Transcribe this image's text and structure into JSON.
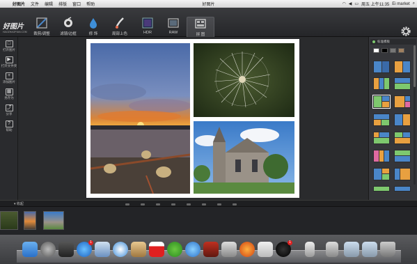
{
  "menubar": {
    "app_name": "好图片",
    "items": [
      "文件",
      "编辑",
      "排版",
      "窗口",
      "帮助"
    ],
    "window_title": "好图片",
    "clock": "周五 上午11:35",
    "user": "Ei market"
  },
  "toolbar": {
    "logo_text": "好图片",
    "logo_sub": "HAOZHAOPIAN.COM",
    "tools": [
      {
        "label": "裁剪/调整",
        "icon": "crop-pen-icon"
      },
      {
        "label": "滤镜/边框",
        "icon": "filter-icon"
      },
      {
        "label": "修 饰",
        "icon": "drop-icon"
      },
      {
        "label": "局部上色",
        "icon": "brush-icon"
      },
      {
        "label": "HDR",
        "icon": "hdr-icon"
      },
      {
        "label": "RAW",
        "icon": "raw-icon"
      },
      {
        "label": "拼 图",
        "icon": "collage-icon"
      }
    ],
    "active_tool": "拼 图"
  },
  "sidebar": {
    "items": [
      {
        "label": "打开图片",
        "icon": "open-image-icon",
        "glyph": "□"
      },
      {
        "label": "打开文件夹",
        "icon": "open-folder-icon",
        "glyph": "▶"
      },
      {
        "label": "添加图片",
        "icon": "add-image-icon",
        "glyph": "+"
      },
      {
        "label": "另存为",
        "icon": "save-as-icon",
        "glyph": "▦"
      },
      {
        "label": "分享",
        "icon": "share-icon",
        "glyph": "⤴"
      },
      {
        "label": "帮助",
        "icon": "help-icon",
        "glyph": "?"
      }
    ]
  },
  "right_panel": {
    "header": "标准模板",
    "swatch_colors": [
      "#ffffff",
      "#000000",
      "#777777",
      "#a08060"
    ]
  },
  "bottom": {
    "expand_label": "▾ 收起"
  },
  "colors": {
    "accent_blue": "#4a86c8",
    "accent_orange": "#e8a040",
    "accent_green": "#7ec86e"
  }
}
